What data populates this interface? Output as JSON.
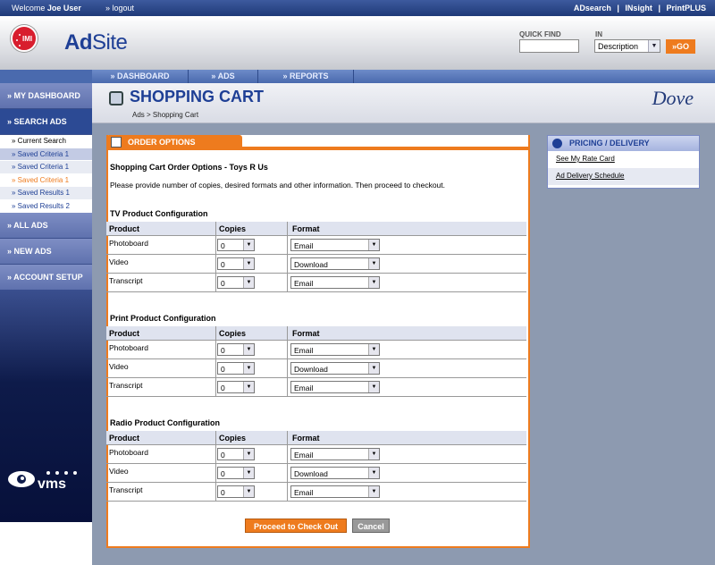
{
  "topbar": {
    "welcome": "Welcome",
    "user": "Joe User",
    "logout": "» logout",
    "links": [
      "ADsearch",
      "|",
      "INsight",
      "|",
      "PrintPLUS"
    ]
  },
  "header": {
    "logo_text": "IMI",
    "brand_ad": "Ad",
    "brand_site": "Site",
    "quick_find": "QUICK FIND",
    "in_label": "IN",
    "in_value": "Description",
    "go": "»GO"
  },
  "nav": {
    "tabs": [
      "» DASHBOARD",
      "» ADS",
      "» REPORTS"
    ]
  },
  "sidebar": {
    "my_dashboard": "» MY DASHBOARD",
    "search_ads": "» SEARCH ADS",
    "sub_items": [
      "» Current Search",
      "» Saved Criteria 1",
      "» Saved Criteria 1",
      "» Saved Criteria 1",
      "» Saved Results 1",
      "» Saved Results 2"
    ],
    "all_ads": "» ALL ADS",
    "new_ads": "» NEW ADS",
    "account_setup": "» ACCOUNT SETUP",
    "vms": "vms"
  },
  "page": {
    "title": "SHOPPING CART",
    "breadcrumb": "Ads >  Shopping Cart",
    "brand": "Dove"
  },
  "panel": {
    "tab": "ORDER OPTIONS",
    "title": "Shopping Cart Order Options - Toys R Us",
    "description": "Please provide number of copies, desired formats and other information. Then proceed to checkout.",
    "headers": {
      "product": "Product",
      "copies": "Copies",
      "format": "Format"
    },
    "sections": [
      {
        "title": "TV Product Configuration",
        "rows": [
          {
            "product": "Photoboard",
            "copies": "0",
            "format": "Email"
          },
          {
            "product": "Video",
            "copies": "0",
            "format": "Download"
          },
          {
            "product": "Transcript",
            "copies": "0",
            "format": "Email"
          }
        ]
      },
      {
        "title": "Print Product Configuration",
        "rows": [
          {
            "product": "Photoboard",
            "copies": "0",
            "format": "Email"
          },
          {
            "product": "Video",
            "copies": "0",
            "format": "Download"
          },
          {
            "product": "Transcript",
            "copies": "0",
            "format": "Email"
          }
        ]
      },
      {
        "title": "Radio Product Configuration",
        "rows": [
          {
            "product": "Photoboard",
            "copies": "0",
            "format": "Email"
          },
          {
            "product": "Video",
            "copies": "0",
            "format": "Download"
          },
          {
            "product": "Transcript",
            "copies": "0",
            "format": "Email"
          }
        ]
      }
    ],
    "checkout": "Proceed to Check Out",
    "cancel": "Cancel"
  },
  "pricing": {
    "title": "PRICING / DELIVERY",
    "links": [
      "See My Rate Card",
      "Ad Delivery Schedule"
    ]
  }
}
